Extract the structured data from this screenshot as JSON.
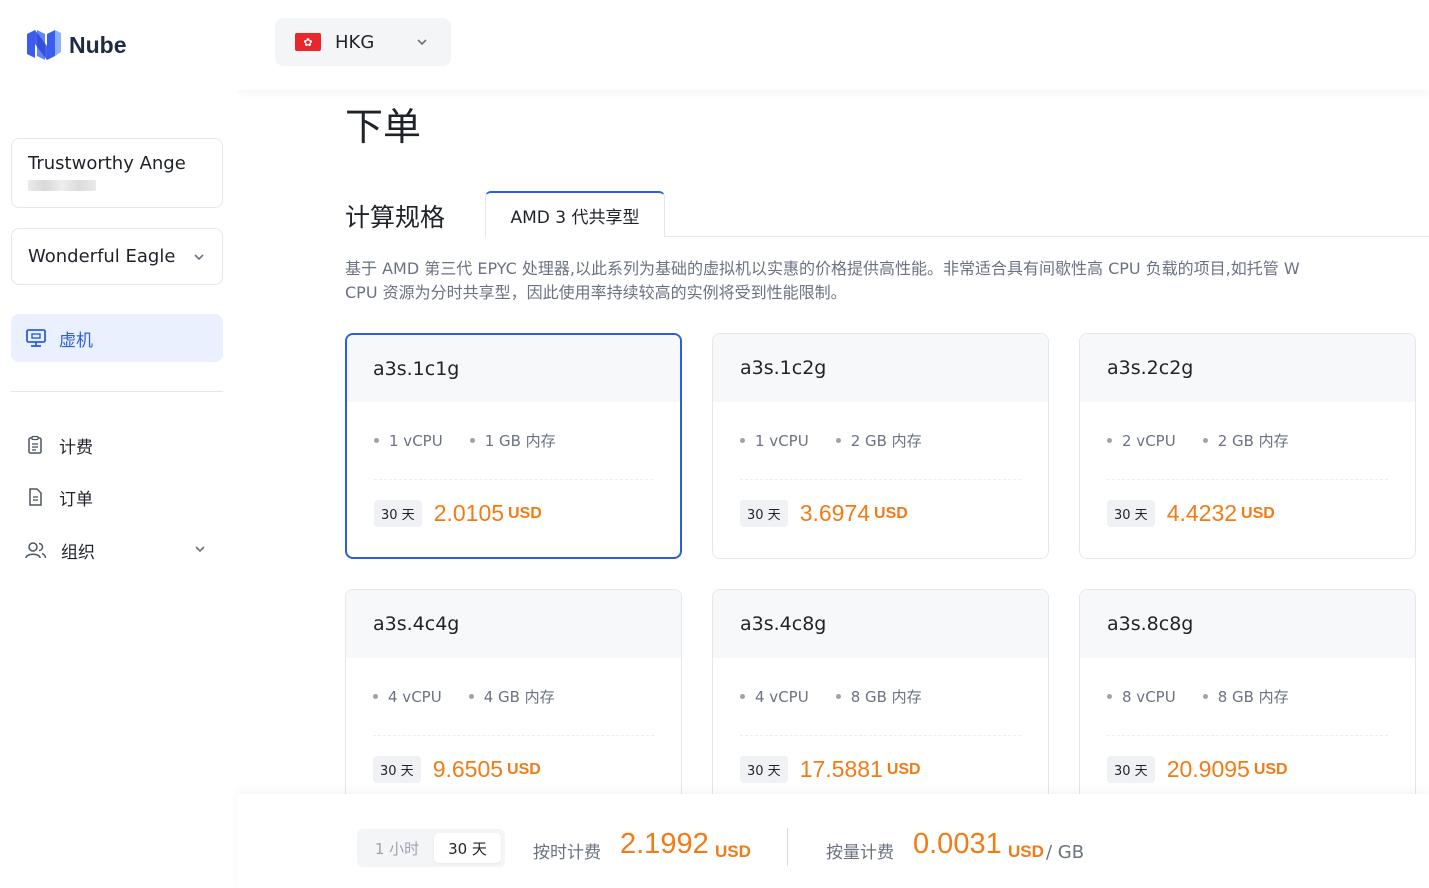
{
  "brand": {
    "name": "Nube"
  },
  "user": {
    "name": "Trustworthy Ange"
  },
  "org_select": {
    "value": "Wonderful Eagle"
  },
  "nav": {
    "active": {
      "label": "虚机"
    },
    "items": [
      {
        "label": "计费"
      },
      {
        "label": "订单"
      },
      {
        "label": "组织"
      }
    ]
  },
  "region": {
    "code": "HKG",
    "flag": "🇭🇰"
  },
  "page": {
    "title": "下单"
  },
  "section": {
    "title": "计算规格",
    "tab": "AMD 3 代共享型"
  },
  "description": {
    "line1": "基于 AMD 第三代 EPYC 处理器,以此系列为基础的虚拟机以实惠的价格提供高性能。非常适合具有间歇性高 CPU 负载的项目,如托管 W",
    "line2": "CPU 资源为分时共享型，因此使用率持续较高的实例将受到性能限制。"
  },
  "plans": [
    {
      "name": "a3s.1c1g",
      "cpu": "1 vCPU",
      "mem": "1 GB 内存",
      "period": "30 天",
      "price": "2.0105",
      "unit": "USD"
    },
    {
      "name": "a3s.1c2g",
      "cpu": "1 vCPU",
      "mem": "2 GB 内存",
      "period": "30 天",
      "price": "3.6974",
      "unit": "USD"
    },
    {
      "name": "a3s.2c2g",
      "cpu": "2 vCPU",
      "mem": "2 GB 内存",
      "period": "30 天",
      "price": "4.4232",
      "unit": "USD"
    },
    {
      "name": "a3s.4c4g",
      "cpu": "4 vCPU",
      "mem": "4 GB 内存",
      "period": "30 天",
      "price": "9.6505",
      "unit": "USD"
    },
    {
      "name": "a3s.4c8g",
      "cpu": "4 vCPU",
      "mem": "8 GB 内存",
      "period": "30 天",
      "price": "17.5881",
      "unit": "USD"
    },
    {
      "name": "a3s.8c8g",
      "cpu": "8 vCPU",
      "mem": "8 GB 内存",
      "period": "30 天",
      "price": "20.9095",
      "unit": "USD"
    }
  ],
  "billing": {
    "toggle": {
      "hour": "1 小时",
      "month": "30 天"
    },
    "hourly_label": "按时计费",
    "hourly_value": "2.1992",
    "hourly_unit": "USD",
    "usage_label": "按量计费",
    "usage_value": "0.0031",
    "usage_unit": "USD",
    "usage_per": "/ GB"
  },
  "colors": {
    "accent": "#2c5ee0",
    "price": "#f27b16",
    "flag": "#e8262c"
  }
}
